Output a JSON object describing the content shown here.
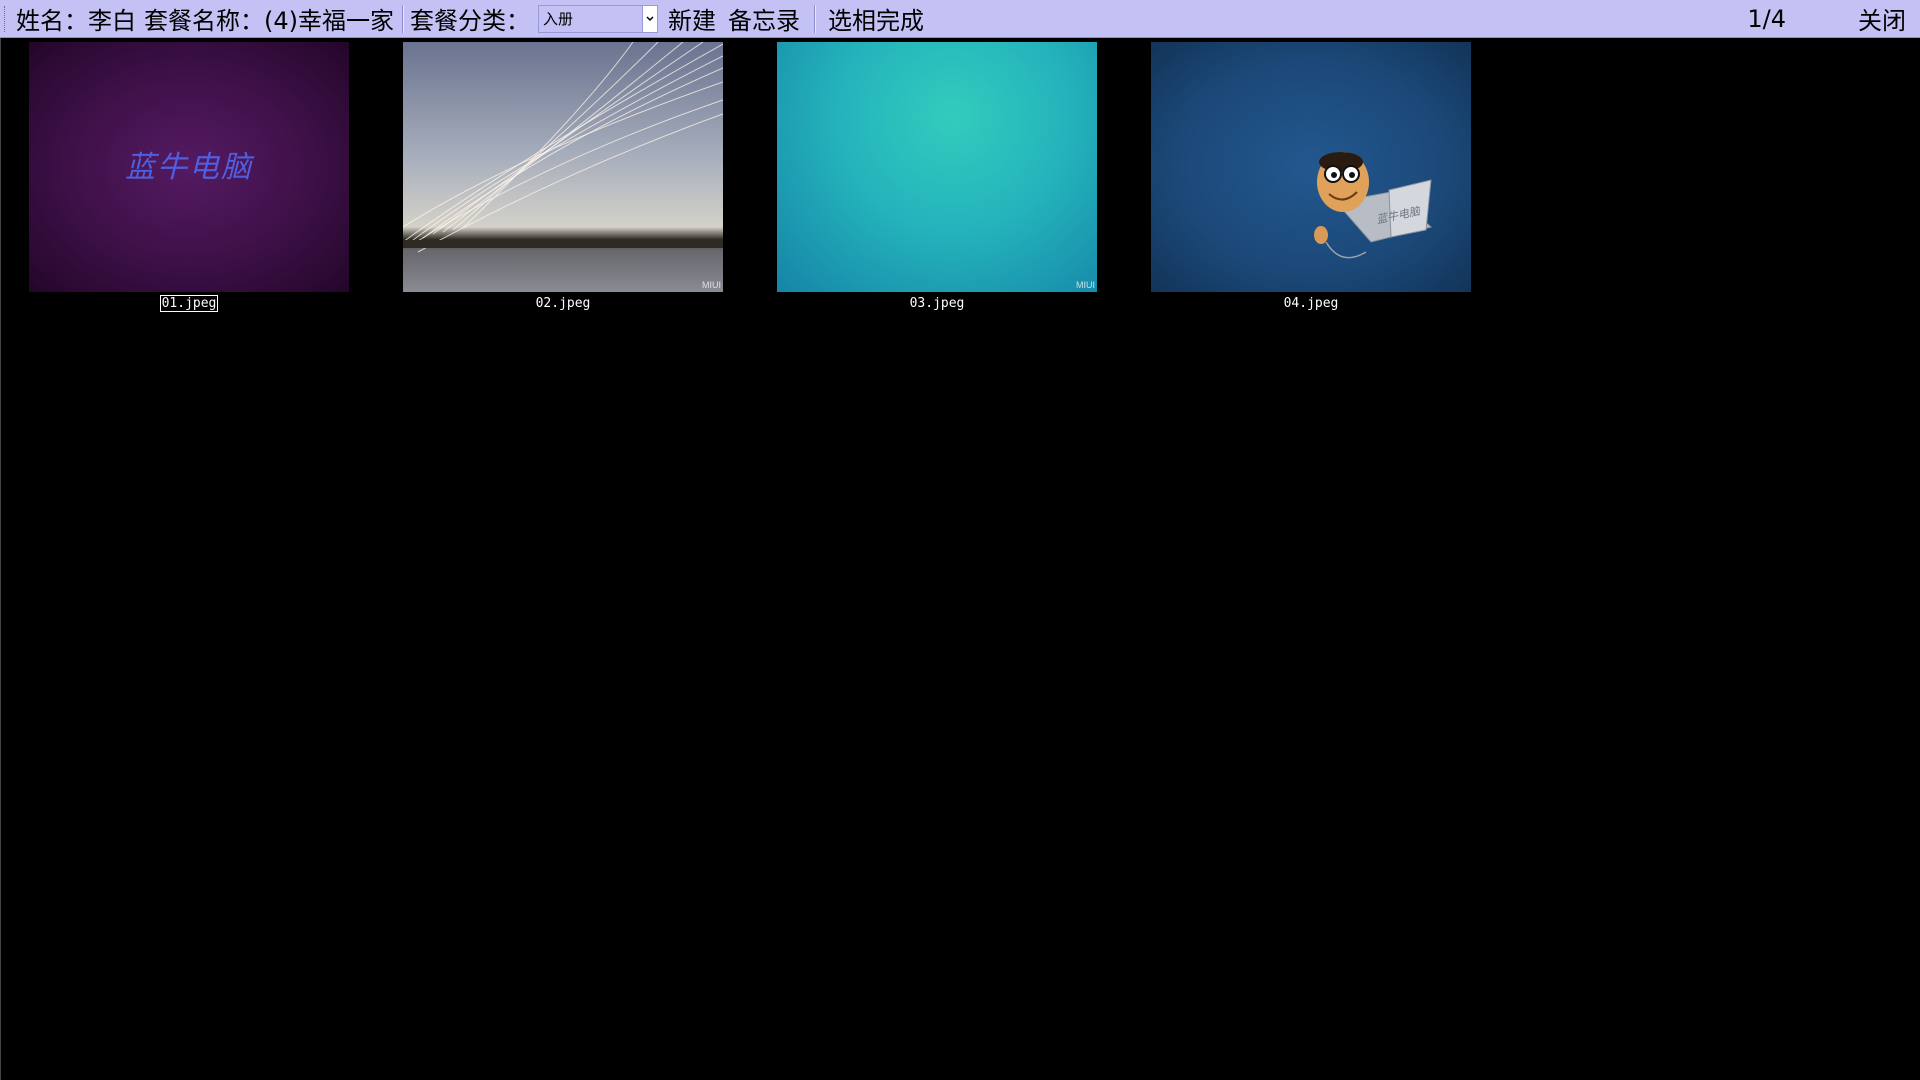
{
  "toolbar": {
    "name_label": "姓名：李白",
    "package_label": "套餐名称：(4)幸福一家",
    "category_label": "套餐分类：",
    "category_value": "入册",
    "new_button": "新建",
    "memo_button": "备忘录",
    "done_button": "选相完成",
    "page_indicator": "1/4",
    "close_button": "关闭"
  },
  "thumbnails": [
    {
      "filename": "01.jpeg",
      "overlay_text": "蓝牛电脑",
      "selected": true
    },
    {
      "filename": "02.jpeg",
      "watermark": "MIUI"
    },
    {
      "filename": "03.jpeg",
      "watermark": "MIUI"
    },
    {
      "filename": "04.jpeg",
      "overlay_text": "蓝牛电脑"
    }
  ],
  "colors": {
    "toolbar_bg": "#c4c2f5",
    "gallery_bg": "#000000",
    "caption_text": "#ffffff"
  }
}
